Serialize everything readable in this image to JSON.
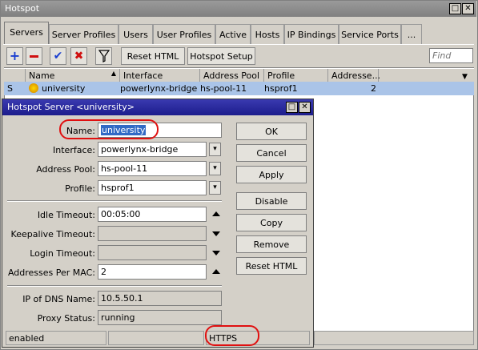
{
  "window": {
    "title": "Hotspot"
  },
  "tabs": [
    "Servers",
    "Server Profiles",
    "Users",
    "User Profiles",
    "Active",
    "Hosts",
    "IP Bindings",
    "Service Ports",
    "..."
  ],
  "toolbar": {
    "reset_html": "Reset HTML",
    "hotspot_setup": "Hotspot Setup",
    "find_placeholder": "Find"
  },
  "table": {
    "headers": [
      "Name",
      "Interface",
      "Address Pool",
      "Profile",
      "Addresse..."
    ],
    "row": {
      "flag": "S",
      "name": "university",
      "interface": "powerlynx-bridge",
      "pool": "hs-pool-11",
      "profile": "hsprof1",
      "addresses": "2"
    }
  },
  "dialog": {
    "title": "Hotspot Server <university>",
    "labels": {
      "name": "Name:",
      "interface": "Interface:",
      "address_pool": "Address Pool:",
      "profile": "Profile:",
      "idle_timeout": "Idle Timeout:",
      "keepalive_timeout": "Keepalive Timeout:",
      "login_timeout": "Login Timeout:",
      "addresses_per_mac": "Addresses Per MAC:",
      "ip_dns": "IP of DNS Name:",
      "proxy_status": "Proxy Status:"
    },
    "values": {
      "name": "university",
      "interface": "powerlynx-bridge",
      "address_pool": "hs-pool-11",
      "profile": "hsprof1",
      "idle_timeout": "00:05:00",
      "addresses_per_mac": "2",
      "ip_dns": "10.5.50.1",
      "proxy_status": "running"
    },
    "buttons": [
      "OK",
      "Cancel",
      "Apply",
      "Disable",
      "Copy",
      "Remove",
      "Reset HTML"
    ],
    "status": {
      "left": "enabled",
      "right": "HTTPS"
    }
  },
  "colors": {
    "dialog_title": "#1c1c8c",
    "selection": "#aac4e8",
    "highlight_oval": "#e01010"
  }
}
